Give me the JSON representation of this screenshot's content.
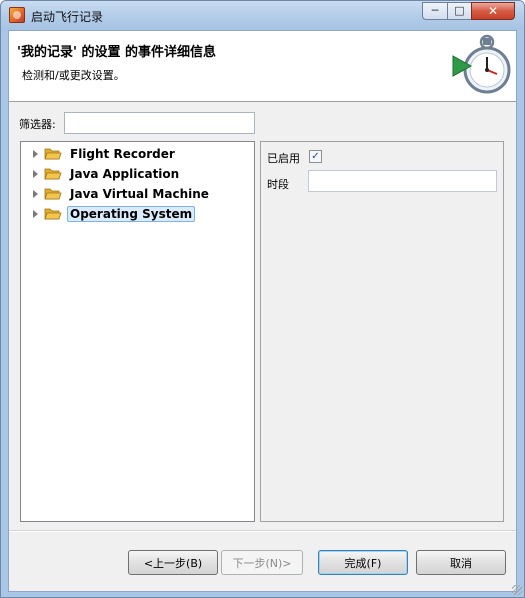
{
  "window": {
    "title": "启动飞行记录",
    "minimize_symbol": "─",
    "maximize_symbol": "□",
    "close_symbol": "✕"
  },
  "header": {
    "title": "'我的记录' 的设置 的事件详细信息",
    "description": "检测和/或更改设置。",
    "graphic_icon": "stopwatch-play-icon"
  },
  "filter": {
    "label": "筛选器:",
    "value": "",
    "placeholder": ""
  },
  "tree": {
    "items": [
      {
        "label": "Flight Recorder",
        "expanded": false,
        "selected": false
      },
      {
        "label": "Java Application",
        "expanded": false,
        "selected": false
      },
      {
        "label": "Java Virtual Machine",
        "expanded": false,
        "selected": false
      },
      {
        "label": "Operating System",
        "expanded": false,
        "selected": true
      }
    ]
  },
  "properties": {
    "enabled_label": "已启用",
    "enabled_checked": true,
    "check_symbol": "✓",
    "period_label": "时段",
    "period_value": ""
  },
  "buttons": {
    "back": "<上一步(B)",
    "next": "下一步(N)>",
    "finish": "完成(F)",
    "cancel": "取消"
  },
  "colors": {
    "selection_bg": "#d9ebfc",
    "selection_border": "#7fb2e5",
    "folder": "#f2c64e",
    "close_button": "#c9402a"
  }
}
